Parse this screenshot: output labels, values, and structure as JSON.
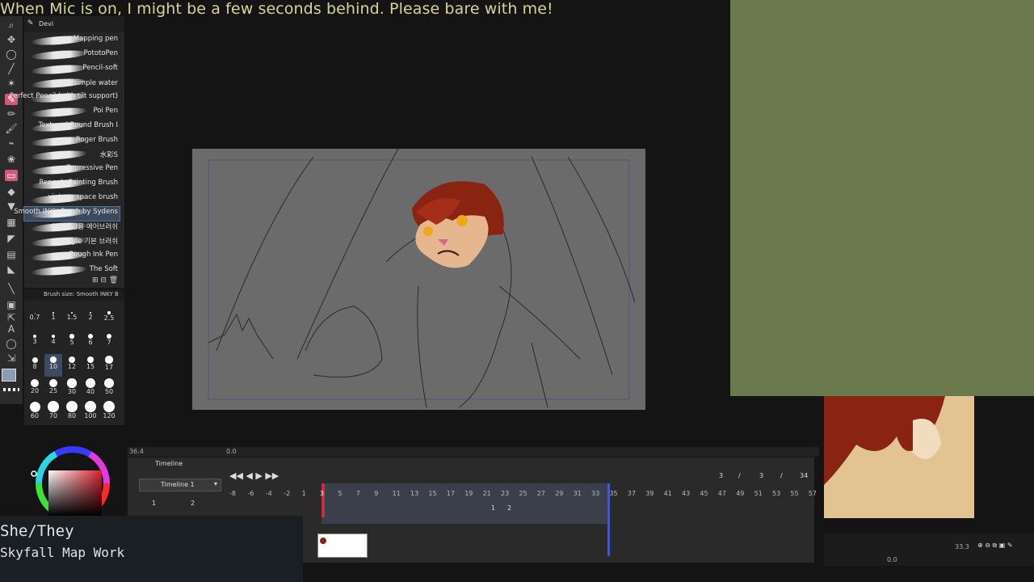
{
  "overlay": {
    "message": "When Mic is on, I might be a few seconds behind. Please bare with me!"
  },
  "brushes": {
    "tab_label": "Devi",
    "items": [
      {
        "label": "Mapping pen"
      },
      {
        "label": "PototoPen"
      },
      {
        "label": "Pencil-soft"
      },
      {
        "label": "연필simple water"
      },
      {
        "label": "Perfect Pencil (with tilt support)"
      },
      {
        "label": "Poi Pen"
      },
      {
        "label": "Textured Round Brush I"
      },
      {
        "label": "Roger Brush"
      },
      {
        "label": "水彩S"
      },
      {
        "label": "Expressive Pen"
      },
      {
        "label": "Renee's Painting Brush"
      },
      {
        "label": "vintage space brush"
      },
      {
        "label": "Smooth INKY Brush by Sydens"
      },
      {
        "label": "수채,질감용 에어브러쉬"
      },
      {
        "label": "K-style 기본 브러쉬"
      },
      {
        "label": "Rough Ink Pen"
      },
      {
        "label": "The Soft"
      }
    ],
    "selected_index": 12
  },
  "brush_size": {
    "header": "Brush size: Smooth INKY B",
    "values": [
      "0.7",
      "1",
      "1.5",
      "2",
      "2.5",
      "3",
      "4",
      "5",
      "6",
      "7",
      "8",
      "10",
      "12",
      "15",
      "17",
      "20",
      "25",
      "30",
      "40",
      "50",
      "60",
      "70",
      "80",
      "100",
      "120"
    ],
    "selected": "10"
  },
  "canvas": {
    "zoom": "36.4",
    "rotation": "0.0"
  },
  "timeline": {
    "tab_label": "Timeline",
    "track_name": "Timeline 1",
    "track_frames": [
      "1",
      "2"
    ],
    "frame_numbers": [
      "-8",
      "-6",
      "-4",
      "-2",
      "1",
      "3",
      "5",
      "7",
      "9",
      "11",
      "13",
      "15",
      "17",
      "19",
      "21",
      "23",
      "25",
      "27",
      "29",
      "31",
      "33",
      "35",
      "37",
      "39",
      "41",
      "43",
      "45",
      "47",
      "49",
      "51",
      "53",
      "55",
      "57"
    ],
    "current_frame": "3",
    "counter": [
      "3",
      "/",
      "3",
      "/",
      "34"
    ],
    "cel_labels": [
      "1",
      "2"
    ]
  },
  "name_panel": {
    "pronouns": "She/They",
    "project": "Skyfall Map Work"
  },
  "nav": {
    "zoom": "33.3",
    "rotation": "0.0"
  },
  "colors": {
    "accent": "#d05a7a",
    "green_panel": "#6b7a4d",
    "overlay_text": "#d8d39a"
  }
}
